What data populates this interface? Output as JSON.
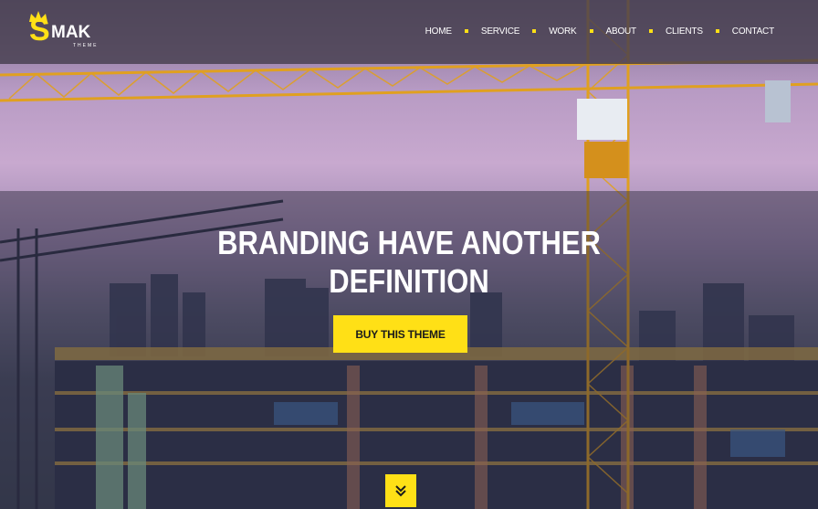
{
  "brand": {
    "logo_letter": "S",
    "logo_word": "MAK",
    "logo_sub": "THEME",
    "accent_color": "#ffe016"
  },
  "nav": {
    "items": [
      {
        "label": "HOME"
      },
      {
        "label": "SERVICE"
      },
      {
        "label": "WORK"
      },
      {
        "label": "ABOUT"
      },
      {
        "label": "CLIENTS"
      },
      {
        "label": "CONTACT"
      }
    ]
  },
  "hero": {
    "headline_line1": "BRANDING HAVE ANOTHER",
    "headline_line2": "DEFINITION",
    "cta_label": "BUY THIS THEME",
    "scroll_icon": "double-chevron-down-icon"
  }
}
